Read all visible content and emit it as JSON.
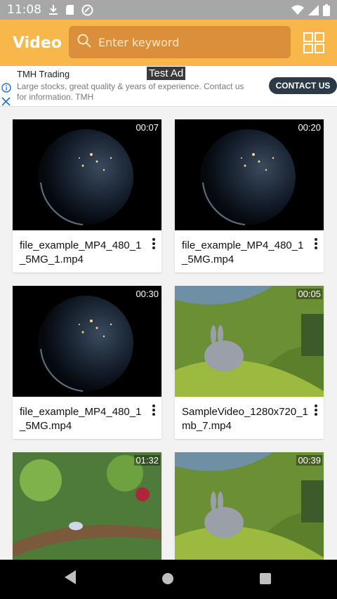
{
  "status_bar": {
    "time": "11:08"
  },
  "app_bar": {
    "title": "Video"
  },
  "search": {
    "placeholder": "Enter keyword"
  },
  "ad": {
    "label": "Test Ad",
    "title": "TMH Trading",
    "description": "Large stocks, great quality & years of experience. Contact us for information. TMH",
    "cta": "CONTACT US"
  },
  "videos": [
    {
      "title": "file_example_MP4_480_1_5MG_1.mp4",
      "duration": "00:07",
      "thumbnail": "earth-night"
    },
    {
      "title": "file_example_MP4_480_1_5MG.mp4",
      "duration": "00:20",
      "thumbnail": "earth-night"
    },
    {
      "title": "file_example_MP4_480_1_5MG.mp4",
      "duration": "00:30",
      "thumbnail": "earth-night"
    },
    {
      "title": "SampleVideo_1280x720_1mb_7.mp4",
      "duration": "00:05",
      "thumbnail": "bunny-meadow"
    },
    {
      "title": "",
      "duration": "01:32",
      "thumbnail": "forest-branch"
    },
    {
      "title": "",
      "duration": "00:39",
      "thumbnail": "bunny-meadow"
    }
  ],
  "colors": {
    "accent": "#f8b74b",
    "search_bg": "#dc8f3a",
    "cta_bg": "#2b3a45"
  }
}
